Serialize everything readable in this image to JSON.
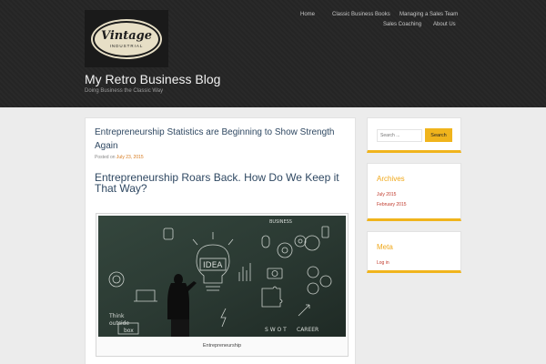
{
  "header": {
    "logo": {
      "wordmark": "Vintage",
      "subtext": "INDUSTRIAL"
    },
    "site_title": "My Retro Business Blog",
    "tagline": "Doing Business the Classic Way",
    "nav": [
      "Home",
      "Classic Business Books",
      "Managing a Sales Team",
      "Sales Coaching",
      "About Us"
    ]
  },
  "post": {
    "title": "Entrepreneurship Statistics are Beginning to Show Strength Again",
    "meta_prefix": "Posted on",
    "date": "July 23, 2015",
    "heading": "Entrepreneurship Roars Back. How Do We Keep it That Way?",
    "image": {
      "caption": "Entrepreneurship",
      "board_words": [
        "IDEA",
        "BUSINESS",
        "S W O T",
        "CAREER",
        "Think",
        "outside",
        "box"
      ],
      "colors": {
        "board": "#2b3a33",
        "chalk": "#e8ece8"
      }
    }
  },
  "sidebar": {
    "search": {
      "placeholder": "Search ...",
      "button": "Search"
    },
    "archives": {
      "title": "Archives",
      "items": [
        "July 2015",
        "February 2015"
      ]
    },
    "meta": {
      "title": "Meta",
      "items": [
        "Log in"
      ]
    }
  },
  "colors": {
    "header_bg": "#262626",
    "page_bg": "#ececec",
    "accent": "#f0b41c",
    "heading": "#2f4862",
    "link": "#c0392b"
  }
}
